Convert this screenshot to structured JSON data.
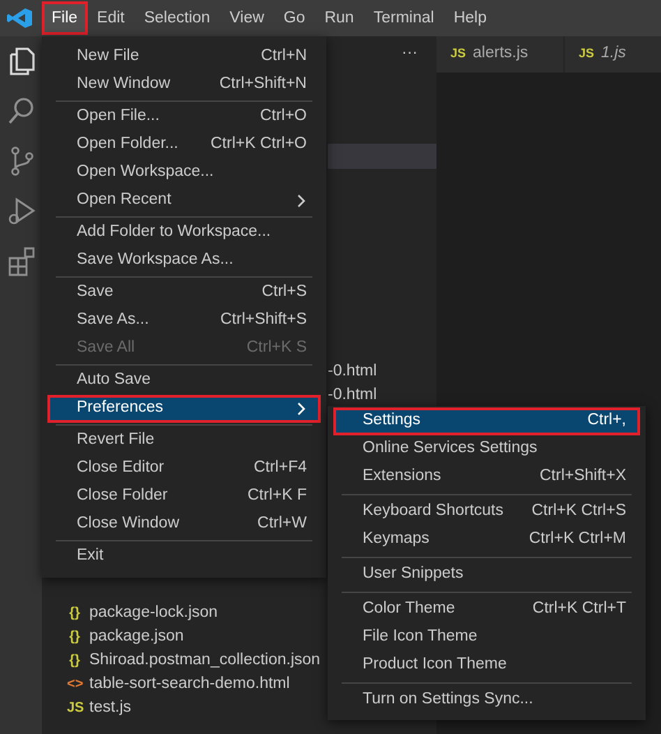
{
  "menubar": [
    {
      "label": "File",
      "selected": true,
      "outlined": true
    },
    {
      "label": "Edit",
      "selected": false,
      "outlined": false
    },
    {
      "label": "Selection",
      "selected": false,
      "outlined": false
    },
    {
      "label": "View",
      "selected": false,
      "outlined": false
    },
    {
      "label": "Go",
      "selected": false,
      "outlined": false
    },
    {
      "label": "Run",
      "selected": false,
      "outlined": false
    },
    {
      "label": "Terminal",
      "selected": false,
      "outlined": false
    },
    {
      "label": "Help",
      "selected": false,
      "outlined": false
    }
  ],
  "activity_bar": [
    {
      "kind": "files",
      "selected": true
    },
    {
      "kind": "search",
      "selected": false
    },
    {
      "kind": "source-control",
      "selected": false
    },
    {
      "kind": "run",
      "selected": false
    },
    {
      "kind": "extensions",
      "selected": false
    }
  ],
  "sidebar": {
    "more": "···",
    "partial_items": [
      "-0.html",
      "-0.html"
    ],
    "files": [
      {
        "kind": "json",
        "icon": "{}",
        "name": "package-lock.json"
      },
      {
        "kind": "json",
        "icon": "{}",
        "name": "package.json"
      },
      {
        "kind": "json",
        "icon": "{}",
        "name": "Shiroad.postman_collection.json"
      },
      {
        "kind": "html",
        "icon": "<>",
        "name": "table-sort-search-demo.html"
      },
      {
        "kind": "js",
        "icon": "JS",
        "name": "test.js"
      }
    ]
  },
  "tabs": [
    {
      "badge": "JS",
      "label": "alerts.js",
      "preview": false
    },
    {
      "badge": "JS",
      "label": "1.js",
      "preview": true
    }
  ],
  "file_menu": [
    [
      {
        "label": "New File",
        "shortcut": "Ctrl+N",
        "disabled": false,
        "submenu": false,
        "selected": false,
        "outlined": false
      },
      {
        "label": "New Window",
        "shortcut": "Ctrl+Shift+N",
        "disabled": false,
        "submenu": false,
        "selected": false,
        "outlined": false
      }
    ],
    [
      {
        "label": "Open File...",
        "shortcut": "Ctrl+O",
        "disabled": false,
        "submenu": false,
        "selected": false,
        "outlined": false
      },
      {
        "label": "Open Folder...",
        "shortcut": "Ctrl+K Ctrl+O",
        "disabled": false,
        "submenu": false,
        "selected": false,
        "outlined": false
      },
      {
        "label": "Open Workspace...",
        "disabled": false,
        "submenu": false,
        "selected": false,
        "outlined": false
      },
      {
        "label": "Open Recent",
        "disabled": false,
        "submenu": true,
        "selected": false,
        "outlined": false
      }
    ],
    [
      {
        "label": "Add Folder to Workspace...",
        "disabled": false,
        "submenu": false,
        "selected": false,
        "outlined": false
      },
      {
        "label": "Save Workspace As...",
        "disabled": false,
        "submenu": false,
        "selected": false,
        "outlined": false
      }
    ],
    [
      {
        "label": "Save",
        "shortcut": "Ctrl+S",
        "disabled": false,
        "submenu": false,
        "selected": false,
        "outlined": false
      },
      {
        "label": "Save As...",
        "shortcut": "Ctrl+Shift+S",
        "disabled": false,
        "submenu": false,
        "selected": false,
        "outlined": false
      },
      {
        "label": "Save All",
        "shortcut": "Ctrl+K S",
        "disabled": true,
        "submenu": false,
        "selected": false,
        "outlined": false
      }
    ],
    [
      {
        "label": "Auto Save",
        "disabled": false,
        "submenu": false,
        "selected": false,
        "outlined": false
      },
      {
        "label": "Preferences",
        "disabled": false,
        "submenu": true,
        "selected": true,
        "outlined": true
      }
    ],
    [
      {
        "label": "Revert File",
        "disabled": false,
        "submenu": false,
        "selected": false,
        "outlined": false
      },
      {
        "label": "Close Editor",
        "shortcut": "Ctrl+F4",
        "disabled": false,
        "submenu": false,
        "selected": false,
        "outlined": false
      },
      {
        "label": "Close Folder",
        "shortcut": "Ctrl+K F",
        "disabled": false,
        "submenu": false,
        "selected": false,
        "outlined": false
      },
      {
        "label": "Close Window",
        "shortcut": "Ctrl+W",
        "disabled": false,
        "submenu": false,
        "selected": false,
        "outlined": false
      }
    ],
    [
      {
        "label": "Exit",
        "disabled": false,
        "submenu": false,
        "selected": false,
        "outlined": false
      }
    ]
  ],
  "preferences_menu": [
    [
      {
        "label": "Settings",
        "shortcut": "Ctrl+,",
        "disabled": false,
        "submenu": false,
        "selected": true,
        "outlined": true
      },
      {
        "label": "Online Services Settings",
        "disabled": false,
        "submenu": false,
        "selected": false,
        "outlined": false
      },
      {
        "label": "Extensions",
        "shortcut": "Ctrl+Shift+X",
        "disabled": false,
        "submenu": false,
        "selected": false,
        "outlined": false
      }
    ],
    [
      {
        "label": "Keyboard Shortcuts",
        "shortcut": "Ctrl+K Ctrl+S",
        "disabled": false,
        "submenu": false,
        "selected": false,
        "outlined": false
      },
      {
        "label": "Keymaps",
        "shortcut": "Ctrl+K Ctrl+M",
        "disabled": false,
        "submenu": false,
        "selected": false,
        "outlined": false
      }
    ],
    [
      {
        "label": "User Snippets",
        "disabled": false,
        "submenu": false,
        "selected": false,
        "outlined": false
      }
    ],
    [
      {
        "label": "Color Theme",
        "shortcut": "Ctrl+K Ctrl+T",
        "disabled": false,
        "submenu": false,
        "selected": false,
        "outlined": false
      },
      {
        "label": "File Icon Theme",
        "disabled": false,
        "submenu": false,
        "selected": false,
        "outlined": false
      },
      {
        "label": "Product Icon Theme",
        "disabled": false,
        "submenu": false,
        "selected": false,
        "outlined": false
      }
    ],
    [
      {
        "label": "Turn on Settings Sync...",
        "disabled": false,
        "submenu": false,
        "selected": false,
        "outlined": false
      }
    ]
  ]
}
